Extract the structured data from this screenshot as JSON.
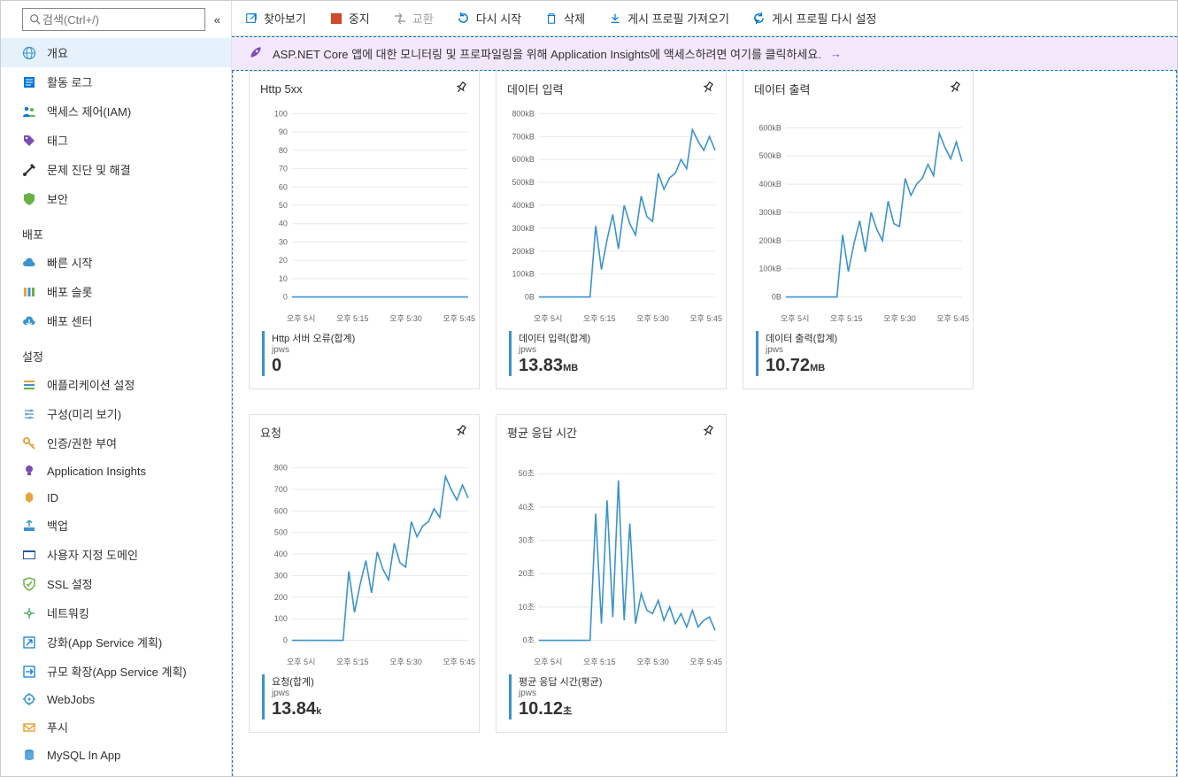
{
  "sidebar": {
    "search_placeholder": "검색(Ctrl+/)",
    "items_top": [
      {
        "label": "개요",
        "icon": "globe",
        "active": true
      },
      {
        "label": "활동 로그",
        "icon": "log"
      },
      {
        "label": "액세스 제어(IAM)",
        "icon": "people"
      },
      {
        "label": "태그",
        "icon": "tag"
      },
      {
        "label": "문제 진단 및 해결",
        "icon": "tools"
      },
      {
        "label": "보안",
        "icon": "shield"
      }
    ],
    "section_deploy": "배포",
    "items_deploy": [
      {
        "label": "빠른 시작",
        "icon": "cloud"
      },
      {
        "label": "배포 슬롯",
        "icon": "slots"
      },
      {
        "label": "배포 센터",
        "icon": "deploy"
      }
    ],
    "section_settings": "설정",
    "items_settings": [
      {
        "label": "애플리케이션 설정",
        "icon": "appsettings"
      },
      {
        "label": "구성(미리 보기)",
        "icon": "config"
      },
      {
        "label": "인증/권한 부여",
        "icon": "key"
      },
      {
        "label": "Application Insights",
        "icon": "bulb"
      },
      {
        "label": "ID",
        "icon": "id"
      },
      {
        "label": "백업",
        "icon": "backup"
      },
      {
        "label": "사용자 지정 도메인",
        "icon": "domain"
      },
      {
        "label": "SSL 설정",
        "icon": "ssl"
      },
      {
        "label": "네트워킹",
        "icon": "network"
      },
      {
        "label": "강화(App Service 계획)",
        "icon": "scaleup"
      },
      {
        "label": "규모 확장(App Service 계획)",
        "icon": "scaleout"
      },
      {
        "label": "WebJobs",
        "icon": "webjobs"
      },
      {
        "label": "푸시",
        "icon": "push"
      },
      {
        "label": "MySQL In App",
        "icon": "mysql"
      }
    ]
  },
  "toolbar": {
    "browse": "찾아보기",
    "stop": "중지",
    "swap": "교환",
    "restart": "다시 시작",
    "delete": "삭제",
    "get": "게시 프로필 가져오기",
    "reset": "게시 프로필 다시 설정"
  },
  "banner": {
    "text": "ASP.NET Core 앱에 대한 모니터링 및 프로파일링을 위해 Application Insights에 액세스하려면 여기를 클릭하세요."
  },
  "x_axis_labels": [
    "오후 5시",
    "오후 5:15",
    "오후 5:30",
    "오후 5:45"
  ],
  "chart_data": [
    {
      "id": "http5xx",
      "type": "line",
      "title": "Http 5xx",
      "ylabel": "",
      "ylim": [
        0,
        100
      ],
      "yticks": [
        0,
        10,
        20,
        30,
        40,
        50,
        60,
        70,
        80,
        90,
        100
      ],
      "x": [
        "오후 5시",
        "오후 5:15",
        "오후 5:30",
        "오후 5:45"
      ],
      "series": [
        {
          "name": "Http 서버 오류(합계)",
          "sub": "jpws",
          "values": [
            0,
            0,
            0,
            0,
            0,
            0,
            0,
            0,
            0,
            0,
            0,
            0,
            0,
            0,
            0,
            0,
            0,
            0,
            0,
            0
          ]
        }
      ],
      "summary": {
        "label": "Http 서버 오류(합계)",
        "sub": "jpws",
        "value": "0",
        "unit": ""
      }
    },
    {
      "id": "datain",
      "type": "line",
      "title": "데이터 입력",
      "ylabel": "",
      "ylim": [
        0,
        800
      ],
      "unit": "kB",
      "yticks": [
        0,
        100,
        200,
        300,
        400,
        500,
        600,
        700,
        800
      ],
      "x": [
        "오후 5시",
        "오후 5:15",
        "오후 5:30",
        "오후 5:45"
      ],
      "series": [
        {
          "name": "데이터 입력(합계)",
          "sub": "jpws",
          "values": [
            0,
            0,
            0,
            0,
            0,
            0,
            0,
            0,
            0,
            0,
            310,
            120,
            250,
            360,
            210,
            400,
            320,
            270,
            440,
            350,
            330,
            540,
            470,
            520,
            540,
            600,
            560,
            730,
            680,
            640,
            700,
            640
          ]
        }
      ],
      "summary": {
        "label": "데이터 입력(합계)",
        "sub": "jpws",
        "value": "13.83",
        "unit": "MB"
      }
    },
    {
      "id": "dataout",
      "type": "line",
      "title": "데이터 출력",
      "ylabel": "",
      "ylim": [
        0,
        650
      ],
      "unit": "kB",
      "yticks": [
        0,
        100,
        200,
        300,
        400,
        500,
        600
      ],
      "x": [
        "오후 5시",
        "오후 5:15",
        "오후 5:30",
        "오후 5:45"
      ],
      "series": [
        {
          "name": "데이터 출력(합계)",
          "sub": "jpws",
          "values": [
            0,
            0,
            0,
            0,
            0,
            0,
            0,
            0,
            0,
            0,
            220,
            90,
            190,
            270,
            160,
            300,
            240,
            200,
            340,
            260,
            250,
            420,
            360,
            400,
            420,
            470,
            430,
            580,
            530,
            490,
            550,
            480
          ]
        }
      ],
      "summary": {
        "label": "데이터 출력(합계)",
        "sub": "jpws",
        "value": "10.72",
        "unit": "MB"
      }
    },
    {
      "id": "requests",
      "type": "line",
      "title": "요청",
      "ylabel": "",
      "ylim": [
        0,
        850
      ],
      "yticks": [
        0,
        100,
        200,
        300,
        400,
        500,
        600,
        700,
        800
      ],
      "x": [
        "오후 5시",
        "오후 5:15",
        "오후 5:30",
        "오후 5:45"
      ],
      "series": [
        {
          "name": "요청(합계)",
          "sub": "jpws",
          "values": [
            0,
            0,
            0,
            0,
            0,
            0,
            0,
            0,
            0,
            0,
            320,
            130,
            260,
            370,
            220,
            410,
            330,
            280,
            450,
            360,
            340,
            550,
            480,
            530,
            550,
            610,
            570,
            760,
            700,
            650,
            720,
            660
          ]
        }
      ],
      "summary": {
        "label": "요청(합계)",
        "sub": "jpws",
        "value": "13.84",
        "unit": "k"
      }
    },
    {
      "id": "avgresp",
      "type": "line",
      "title": "평균 응답 시간",
      "ylabel": "",
      "ylim": [
        0,
        55
      ],
      "unit": "초",
      "yticks": [
        0,
        10,
        20,
        30,
        40,
        50
      ],
      "x": [
        "오후 5시",
        "오후 5:15",
        "오후 5:30",
        "오후 5:45"
      ],
      "series": [
        {
          "name": "평균 응답 시간(평균)",
          "sub": "jpws",
          "values": [
            0,
            0,
            0,
            0,
            0,
            0,
            0,
            0,
            0,
            0,
            38,
            5,
            42,
            7,
            48,
            6,
            35,
            5,
            14,
            9,
            8,
            12,
            6,
            10,
            5,
            8,
            4,
            9,
            4,
            6,
            7,
            3
          ]
        }
      ],
      "summary": {
        "label": "평균 응답 시간(평균)",
        "sub": "jpws",
        "value": "10.12",
        "unit": "초"
      }
    }
  ]
}
